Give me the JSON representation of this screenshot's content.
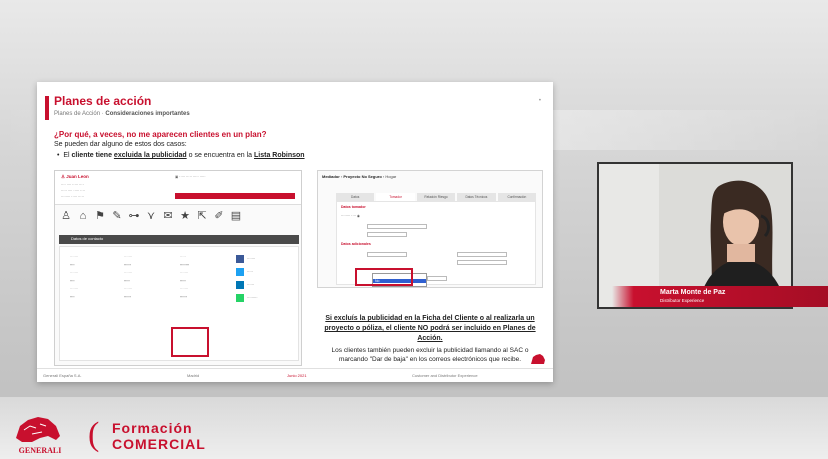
{
  "slide": {
    "title": "Planes de acción",
    "subtitle_prefix": "Planes de Acción · ",
    "subtitle_bold": "Consideraciones importantes",
    "question": "¿Por qué, a veces, no me aparecen clientes en un plan?",
    "sub": "Se pueden dar alguno de estos dos casos:",
    "bullet_prefix": "El ",
    "bullet_b1": "cliente tiene ",
    "bullet_u1": "excluida la publicidad",
    "bullet_mid": " o se encuentra en la ",
    "bullet_u2": "Lista Robinson",
    "note_title": "Si excluís la publicidad en la Ficha del Cliente o al realizarla un proyecto o póliza, el cliente NO podrá ser incluido en Planes de Acción.",
    "note_body": "Los clientes también pueden excluir la publicidad llamando al SAC o marcando \"Dar de baja\" en los correos electrónicos que recibe.",
    "footer_left": "Generali España S.A.",
    "footer_mid": "Madrid",
    "footer_date": "Junio 2021",
    "footer_right": "Customer and Distributor Experience"
  },
  "crm_left": {
    "name": "Juan Leon",
    "header": "Datos de contacto"
  },
  "crm_right": {
    "breadcrumb_1": "Mediador",
    "breadcrumb_2": "Proyecto No Seguro",
    "breadcrumb_3": "Hogar",
    "tabs": [
      "Datos",
      "Tomador",
      "Relación Riesgo",
      "Datos Técnicos",
      "Confirmación"
    ],
    "section_1": "Datos tomador",
    "section_2": "Datos adicionales",
    "option_selected": "No"
  },
  "presenter": {
    "name": "Marta Monte de Paz",
    "role": "Distributor Experience"
  },
  "brand": {
    "company": "GENERALI",
    "line1": "Formación",
    "line2": "COMERCIAL"
  },
  "colors": {
    "accent": "#c8102e"
  }
}
